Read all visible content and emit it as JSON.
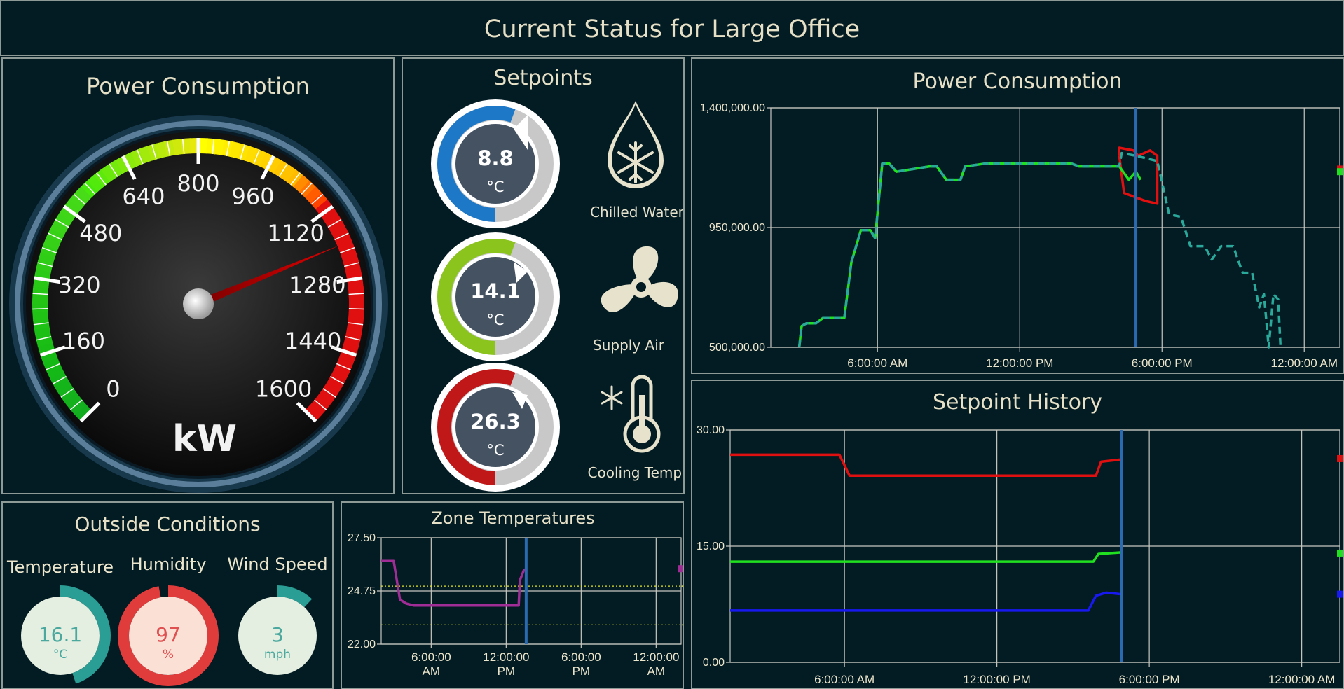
{
  "header": {
    "title": "Current Status for Large Office"
  },
  "gauge": {
    "title": "Power Consumption",
    "unit": "kW",
    "min": 0,
    "max": 1600,
    "value": 1200,
    "ticks": [
      "0",
      "160",
      "320",
      "480",
      "640",
      "800",
      "960",
      "1120",
      "1280",
      "1440",
      "1600"
    ]
  },
  "setpoints": {
    "title": "Setpoints",
    "items": [
      {
        "value": "8.8",
        "unit": "°C",
        "label": "Chilled Water",
        "fraction": 0.5,
        "color": "#1e78c8",
        "icon": "water-drop-snowflake-icon"
      },
      {
        "value": "14.1",
        "unit": "°C",
        "label": "Supply Air",
        "fraction": 0.5,
        "color": "#8cc41e",
        "icon": "fan-icon"
      },
      {
        "value": "26.3",
        "unit": "°C",
        "label": "Cooling Temp.",
        "fraction": 0.5,
        "color": "#c01818",
        "icon": "thermometer-snowflake-icon"
      }
    ]
  },
  "outside": {
    "title": "Outside Conditions",
    "items": [
      {
        "label": "Temperature",
        "value": "16.1",
        "unit": "°C",
        "fraction": 0.45,
        "ring": "#2a9d94",
        "fill": "#e4efe1",
        "text": "#4aa89e"
      },
      {
        "label": "Humidity",
        "value": "97",
        "unit": "%",
        "fraction": 0.97,
        "ring": "#e03c3c",
        "fill": "#fbe0d6",
        "text": "#e05050"
      },
      {
        "label": "Wind Speed",
        "value": "3",
        "unit": "mph",
        "fraction": 0.12,
        "ring": "#2a9d94",
        "fill": "#e4efe1",
        "text": "#4aa89e"
      }
    ]
  },
  "chart_data": [
    {
      "id": "power",
      "type": "line",
      "title": "Power Consumption",
      "xlim": [
        1.5,
        25.5
      ],
      "ylim": [
        500000,
        1400000
      ],
      "yticks": [
        "1,400,000.00",
        "950,000.00",
        "500,000.00"
      ],
      "xticks": [
        {
          "x": 6,
          "label": "6:00:00 AM"
        },
        {
          "x": 12,
          "label": "12:00:00 PM"
        },
        {
          "x": 18,
          "label": "6:00:00 PM"
        },
        {
          "x": 24,
          "label": "12:00:00 AM"
        }
      ],
      "marker_x": 16.9,
      "series": [
        {
          "color": "#e01010",
          "dash": false,
          "points": [
            [
              16.2,
              1220000
            ],
            [
              16.4,
              1080000
            ],
            [
              17.0,
              1060000
            ],
            [
              17.3,
              1050000
            ],
            [
              17.8,
              1040000
            ],
            [
              17.8,
              1220000
            ],
            [
              17.5,
              1240000
            ],
            [
              17.0,
              1220000
            ],
            [
              16.8,
              1240000
            ],
            [
              16.2,
              1250000
            ],
            [
              16.2,
              1220000
            ]
          ]
        },
        {
          "color": "#20e020",
          "dash": false,
          "points": [
            [
              2.7,
              500000
            ],
            [
              2.8,
              580000
            ],
            [
              3.0,
              590000
            ],
            [
              3.4,
              590000
            ],
            [
              3.7,
              610000
            ],
            [
              4.6,
              610000
            ],
            [
              4.9,
              820000
            ],
            [
              5.3,
              940000
            ],
            [
              5.7,
              940000
            ],
            [
              5.9,
              910000
            ],
            [
              6.2,
              1190000
            ],
            [
              6.5,
              1190000
            ],
            [
              6.8,
              1160000
            ],
            [
              8.2,
              1180000
            ],
            [
              8.5,
              1180000
            ],
            [
              8.9,
              1130000
            ],
            [
              9.5,
              1130000
            ],
            [
              9.7,
              1180000
            ],
            [
              10.5,
              1190000
            ],
            [
              12.0,
              1190000
            ],
            [
              13.0,
              1190000
            ],
            [
              14.2,
              1190000
            ],
            [
              14.5,
              1180000
            ],
            [
              16.2,
              1180000
            ],
            [
              16.6,
              1130000
            ],
            [
              16.9,
              1160000
            ],
            [
              17.1,
              1130000
            ]
          ]
        },
        {
          "color": "#2aa89a",
          "dash": true,
          "points": [
            [
              2.7,
              500000
            ],
            [
              2.8,
              580000
            ],
            [
              3.0,
              590000
            ],
            [
              3.4,
              590000
            ],
            [
              3.7,
              610000
            ],
            [
              4.6,
              610000
            ],
            [
              4.9,
              820000
            ],
            [
              5.3,
              940000
            ],
            [
              5.7,
              940000
            ],
            [
              5.9,
              910000
            ],
            [
              6.2,
              1190000
            ],
            [
              6.5,
              1190000
            ],
            [
              6.8,
              1160000
            ],
            [
              8.2,
              1180000
            ],
            [
              8.5,
              1180000
            ],
            [
              8.9,
              1130000
            ],
            [
              9.5,
              1130000
            ],
            [
              9.7,
              1180000
            ],
            [
              10.5,
              1190000
            ],
            [
              12.0,
              1190000
            ],
            [
              13.0,
              1190000
            ],
            [
              14.2,
              1190000
            ],
            [
              14.5,
              1180000
            ],
            [
              16.2,
              1180000
            ],
            [
              16.3,
              1230000
            ],
            [
              16.9,
              1220000
            ],
            [
              17.8,
              1200000
            ],
            [
              18.3,
              1000000
            ],
            [
              18.8,
              990000
            ],
            [
              19.2,
              880000
            ],
            [
              19.8,
              880000
            ],
            [
              20.1,
              830000
            ],
            [
              20.5,
              880000
            ],
            [
              21.0,
              880000
            ],
            [
              21.4,
              780000
            ],
            [
              21.8,
              780000
            ],
            [
              22.1,
              650000
            ],
            [
              22.3,
              700000
            ],
            [
              22.5,
              500000
            ],
            [
              22.7,
              700000
            ],
            [
              22.9,
              680000
            ],
            [
              23.0,
              500000
            ]
          ]
        }
      ],
      "edge_markers": [
        {
          "y": 1170000,
          "color": "#e01010"
        },
        {
          "y": 1160000,
          "color": "#20e020"
        }
      ]
    },
    {
      "id": "history",
      "type": "line",
      "title": "Setpoint History",
      "xlim": [
        1.5,
        25.5
      ],
      "ylim": [
        0,
        30
      ],
      "yticks": [
        "30.00",
        "15.00",
        "0.00"
      ],
      "xticks": [
        {
          "x": 6,
          "label": "6:00:00 AM"
        },
        {
          "x": 12,
          "label": "12:00:00 PM"
        },
        {
          "x": 18,
          "label": "6:00:00 PM"
        },
        {
          "x": 24,
          "label": "12:00:00 AM"
        }
      ],
      "marker_x": 16.9,
      "series": [
        {
          "color": "#e01010",
          "dash": false,
          "points": [
            [
              1.5,
              26.8
            ],
            [
              5.8,
              26.8
            ],
            [
              6.2,
              24.1
            ],
            [
              15.9,
              24.1
            ],
            [
              16.1,
              25.9
            ],
            [
              16.9,
              26.2
            ]
          ]
        },
        {
          "color": "#20e020",
          "dash": false,
          "points": [
            [
              1.5,
              13.0
            ],
            [
              15.8,
              13.0
            ],
            [
              16.0,
              14.0
            ],
            [
              16.9,
              14.2
            ]
          ]
        },
        {
          "color": "#1818f0",
          "dash": false,
          "points": [
            [
              1.5,
              6.7
            ],
            [
              15.6,
              6.7
            ],
            [
              15.9,
              8.6
            ],
            [
              16.3,
              9.0
            ],
            [
              16.9,
              8.8
            ]
          ]
        }
      ],
      "edge_markers": [
        {
          "y": 26.3,
          "color": "#e01010"
        },
        {
          "y": 14.1,
          "color": "#20e020"
        },
        {
          "y": 8.8,
          "color": "#1818f0"
        }
      ]
    },
    {
      "id": "zone",
      "type": "line",
      "title": "Zone Temperatures",
      "xlim": [
        2.0,
        26.0
      ],
      "ylim": [
        22,
        27.5
      ],
      "yticks": [
        "27.50",
        "24.75",
        "22.00"
      ],
      "xticks": [
        {
          "x": 6,
          "label": "6:00:00\nAM"
        },
        {
          "x": 12,
          "label": "12:00:00\nPM"
        },
        {
          "x": 18,
          "label": "6:00:00\nPM"
        },
        {
          "x": 24,
          "label": "12:00:00\nAM"
        }
      ],
      "marker_x": 13.6,
      "bands": [
        25.0,
        23.0
      ],
      "series": [
        {
          "color": "#a02c96",
          "dash": false,
          "points": [
            [
              2.0,
              26.3
            ],
            [
              3.0,
              26.3
            ],
            [
              3.5,
              24.3
            ],
            [
              4.0,
              24.1
            ],
            [
              4.6,
              24.0
            ],
            [
              13.0,
              24.0
            ],
            [
              13.1,
              25.3
            ],
            [
              13.4,
              25.8
            ],
            [
              13.6,
              25.9
            ]
          ]
        }
      ],
      "edge_markers": [
        {
          "y": 25.9,
          "color": "#a02c96"
        }
      ]
    }
  ]
}
